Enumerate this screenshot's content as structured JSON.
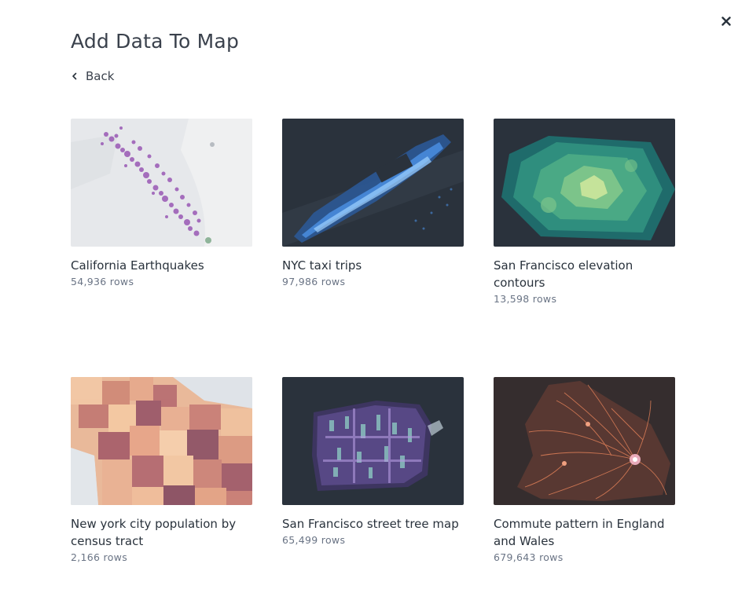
{
  "modal": {
    "title": "Add Data To Map",
    "back_label": "Back",
    "close_icon": "close-icon"
  },
  "datasets": [
    {
      "title": "California Earthquakes",
      "rows": "54,936 rows",
      "thumb_style": "light-map-purple-points"
    },
    {
      "title": "NYC taxi trips",
      "rows": "97,986 rows",
      "thumb_style": "dark-map-blue-points"
    },
    {
      "title": "San Francisco elevation contours",
      "rows": "13,598 rows",
      "thumb_style": "dark-map-green-contours"
    },
    {
      "title": "New york city population by census tract",
      "rows": "2,166 rows",
      "thumb_style": "light-map-orange-extrusions"
    },
    {
      "title": "San Francisco street tree map",
      "rows": "65,499 rows",
      "thumb_style": "dark-map-violet-extrusions"
    },
    {
      "title": "Commute pattern in England and Wales",
      "rows": "679,643 rows",
      "thumb_style": "dark-map-orange-arcs"
    }
  ],
  "colors": {
    "text": "#29323c",
    "muted": "#6a7485",
    "dark_map": "#29323c",
    "light_map": "#e8eaed"
  }
}
